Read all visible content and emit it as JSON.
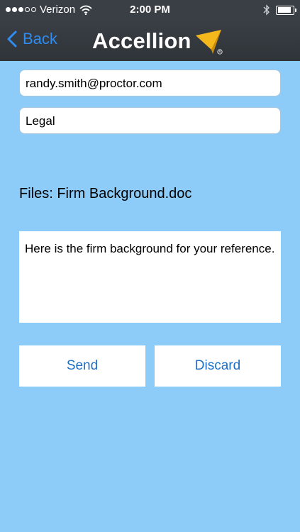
{
  "status_bar": {
    "carrier": "Verizon",
    "time": "2:00 PM",
    "signal_bars_filled": 3,
    "signal_bars_total": 5,
    "battery_level": 0.9
  },
  "nav": {
    "back_label": "Back",
    "brand_name": "Accellion",
    "brand_accent_color": "#f5b81c",
    "back_color": "#2f8cf0"
  },
  "form": {
    "recipient": "randy.smith@proctor.com",
    "subject": "Legal",
    "files_text": "Files: Firm Background.doc",
    "message": "Here is the firm background for your reference."
  },
  "actions": {
    "send_label": "Send",
    "discard_label": "Discard"
  },
  "colors": {
    "background": "#8dcbf8",
    "bar": "#3a3f45",
    "button_text": "#1e6fc4"
  },
  "icons": [
    "back-chevron-icon",
    "wifi-icon",
    "bluetooth-icon",
    "battery-icon",
    "accellion-logo-icon"
  ]
}
